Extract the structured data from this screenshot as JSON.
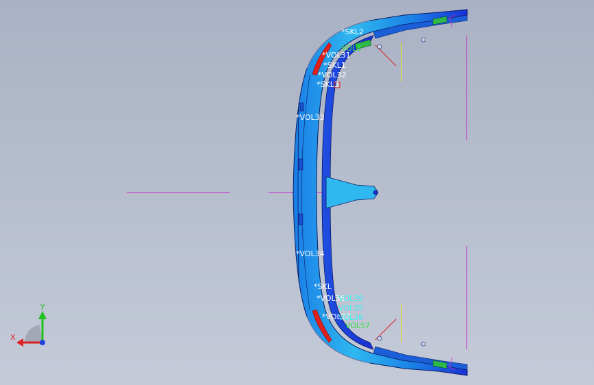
{
  "colors": {
    "background_top": "#a9b1c4",
    "background_bottom": "#c4cad8",
    "part_blue_light": "#2fb8f0",
    "part_blue_mid": "#1a7ee6",
    "part_blue_dark": "#1a2fd6",
    "edge_line": "#0a1a60",
    "red_feature": "#e0201a",
    "green_feature": "#2db84a",
    "axis_magenta": "#cc22cc",
    "axis_yellow": "#e8e020",
    "label_white": "#ffffff",
    "label_cyan": "#38f0f0",
    "label_green": "#30e040",
    "triad_x": "#e02020",
    "triad_y": "#20c020",
    "triad_z": "#2040e0"
  },
  "annotations_white": [
    {
      "id": "skl2",
      "text": "*SKL2"
    },
    {
      "id": "vol31",
      "text": "*VOL31"
    },
    {
      "id": "skl1",
      "text": "*SKL1"
    },
    {
      "id": "vol32",
      "text": "*VOL32"
    },
    {
      "id": "skl3",
      "text": "*SKL3"
    },
    {
      "id": "vol33",
      "text": "*VOL33"
    },
    {
      "id": "vol34",
      "text": "*VOL34"
    },
    {
      "id": "skl",
      "text": "*SKL"
    },
    {
      "id": "vol36",
      "text": "*VOL36"
    },
    {
      "id": "vol37",
      "text": "*VOL37"
    }
  ],
  "annotations_cyan": [
    {
      "id": "vol39",
      "text": "VOL39"
    },
    {
      "id": "vol35",
      "text": "VOL35"
    },
    {
      "id": "vol38",
      "text": "VOL38"
    }
  ],
  "annotations_green": [
    {
      "id": "vol3x",
      "text": "VOL3"
    },
    {
      "id": "vol57",
      "text": "VOL57"
    }
  ],
  "triad": {
    "x_label": "X",
    "y_label": "Y"
  }
}
